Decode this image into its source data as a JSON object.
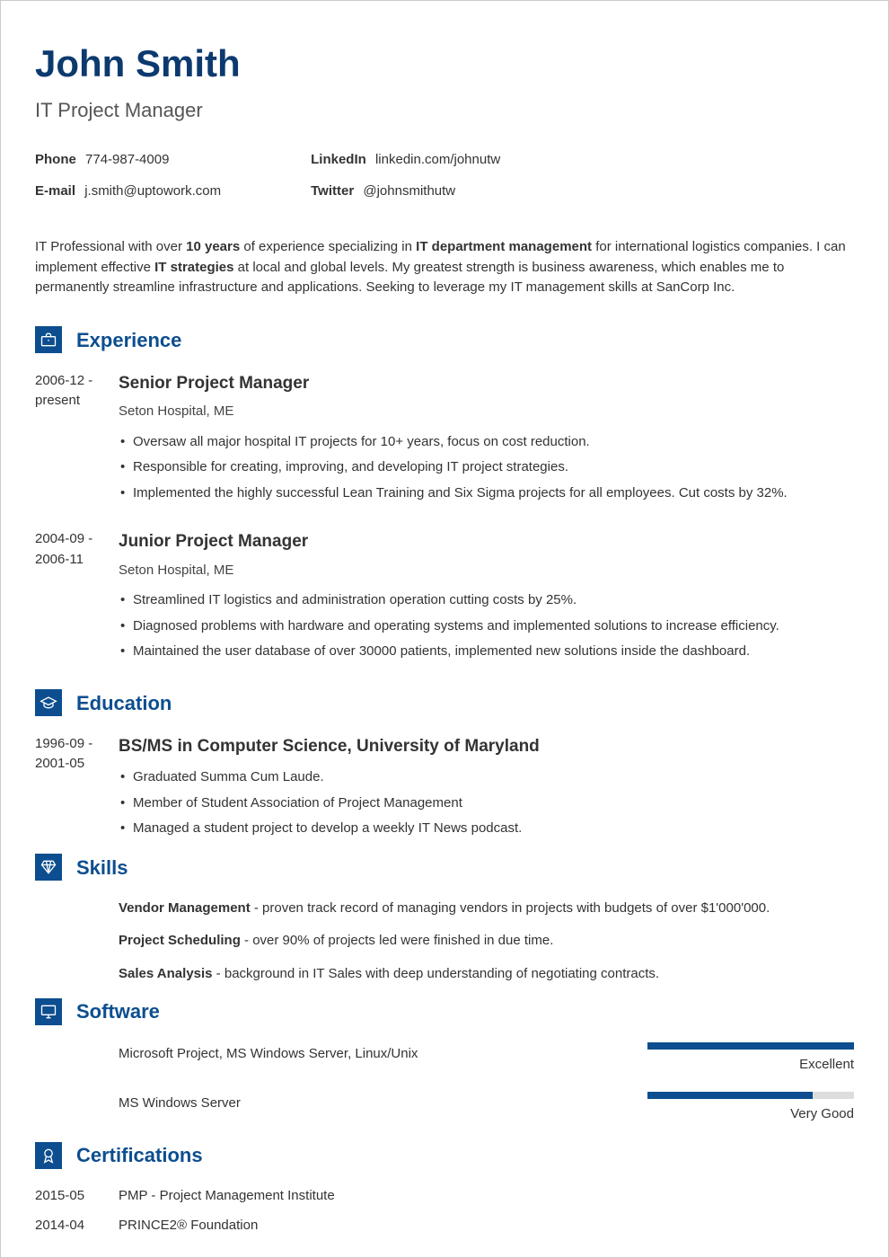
{
  "name": "John Smith",
  "title": "IT Project Manager",
  "contacts": {
    "phone_label": "Phone",
    "phone_value": "774-987-4009",
    "email_label": "E-mail",
    "email_value": "j.smith@uptowork.com",
    "linkedin_label": "LinkedIn",
    "linkedin_value": "linkedin.com/johnutw",
    "twitter_label": "Twitter",
    "twitter_value": "@johnsmithutw"
  },
  "summary": {
    "p1": "IT Professional with over ",
    "b1": "10 years",
    "p2": " of experience specializing in ",
    "b2": "IT department management",
    "p3": " for international logistics companies. I can implement effective ",
    "b3": "IT strategies",
    "p4": " at local and global levels. My greatest strength is business awareness, which enables me to permanently streamline infrastructure and applications. Seeking to leverage my IT management skills at SanCorp Inc."
  },
  "sections": {
    "experience": "Experience",
    "education": "Education",
    "skills": "Skills",
    "software": "Software",
    "certifications": "Certifications"
  },
  "experience": [
    {
      "dates": "2006-12 - present",
      "title": "Senior Project Manager",
      "sub": "Seton Hospital, ME",
      "bullets": [
        "Oversaw all major hospital IT projects for 10+ years, focus on cost reduction.",
        "Responsible for creating, improving, and developing IT project strategies.",
        "Implemented the highly successful Lean Training and Six Sigma projects for all employees. Cut costs by 32%."
      ]
    },
    {
      "dates": "2004-09 - 2006-11",
      "title": "Junior Project Manager",
      "sub": "Seton Hospital, ME",
      "bullets": [
        "Streamlined IT logistics and administration operation cutting costs by 25%.",
        "Diagnosed problems with hardware and operating systems and implemented solutions to increase efficiency.",
        "Maintained the user database of over 30000 patients, implemented new solutions inside the dashboard."
      ]
    }
  ],
  "education": [
    {
      "dates": "1996-09 - 2001-05",
      "title": "BS/MS in Computer Science, University of Maryland",
      "bullets": [
        "Graduated Summa Cum Laude.",
        "Member of Student Association of Project Management",
        "Managed a student project to develop a weekly IT News podcast."
      ]
    }
  ],
  "skills": [
    {
      "name": "Vendor Management",
      "desc": " - proven track record of managing vendors in projects with budgets of over $1'000'000."
    },
    {
      "name": "Project Scheduling",
      "desc": " - over 90% of projects led were finished in due time."
    },
    {
      "name": "Sales Analysis",
      "desc": " - background in IT Sales with deep understanding of negotiating contracts."
    }
  ],
  "software": [
    {
      "label": "Microsoft Project, MS Windows Server, Linux/Unix",
      "level": "Excellent",
      "pct": 100
    },
    {
      "label": "MS Windows Server",
      "level": "Very Good",
      "pct": 80
    }
  ],
  "certifications": [
    {
      "date": "2015-05",
      "name": "PMP - Project Management Institute"
    },
    {
      "date": "2014-04",
      "name": "PRINCE2® Foundation"
    }
  ]
}
